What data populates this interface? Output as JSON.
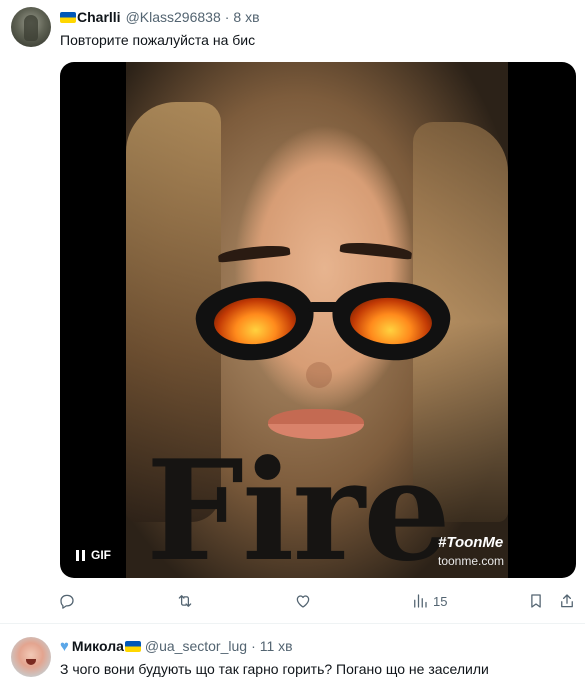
{
  "tweet": {
    "author_name": "Charlli",
    "handle": "@Klass296838",
    "separator": "·",
    "time": "8 хв",
    "text": "Повторите пожалуйста на бис",
    "media": {
      "gif_label": "GIF",
      "overlay_text": "Fire",
      "watermark_tag": "#ToonMe",
      "watermark_url": "toonme.com"
    },
    "actions": {
      "reply_icon": "reply-icon",
      "retweet_icon": "retweet-icon",
      "like_icon": "heart-icon",
      "views_icon": "views-bar-chart-icon",
      "views_count": "15",
      "bookmark_icon": "bookmark-icon",
      "share_icon": "share-icon"
    }
  },
  "reply": {
    "author_name": "Микола",
    "handle": "@ua_sector_lug",
    "separator": "·",
    "time": "11 хв",
    "text": "З чого вони будують що так гарно горить? Погано що не заселили"
  },
  "colors": {
    "text_primary": "#0f1419",
    "text_secondary": "#536471",
    "divider": "#eff3f4",
    "flag_blue": "#0057b8",
    "flag_yellow": "#ffd700",
    "heart_blue": "#5ba7e8"
  }
}
